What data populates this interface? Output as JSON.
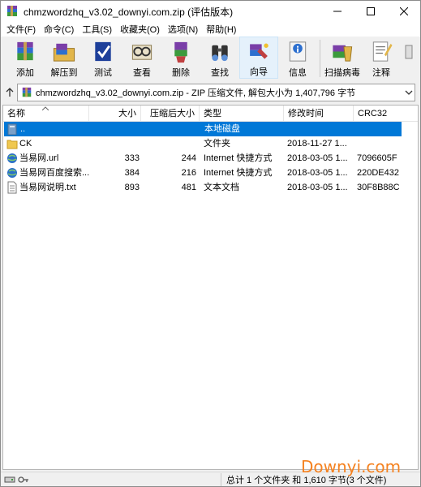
{
  "window": {
    "title": "chmzwordzhq_v3.02_downyi.com.zip (评估版本)",
    "controls": [
      "minimize",
      "maximize",
      "close"
    ]
  },
  "menu": [
    "文件(F)",
    "命令(C)",
    "工具(S)",
    "收藏夹(O)",
    "选项(N)",
    "帮助(H)"
  ],
  "toolbar": [
    {
      "label": "添加",
      "icon": "add-archive-icon"
    },
    {
      "label": "解压到",
      "icon": "extract-icon"
    },
    {
      "label": "测试",
      "icon": "test-icon"
    },
    {
      "label": "查看",
      "icon": "view-icon"
    },
    {
      "label": "删除",
      "icon": "delete-icon"
    },
    {
      "label": "查找",
      "icon": "find-icon"
    },
    {
      "label": "向导",
      "icon": "wizard-icon"
    },
    {
      "label": "信息",
      "icon": "info-icon"
    },
    {
      "label": "扫描病毒",
      "icon": "scan-virus-icon"
    },
    {
      "label": "注释",
      "icon": "comment-icon"
    }
  ],
  "address": {
    "text": "chmzwordzhq_v3.02_downyi.com.zip - ZIP 压缩文件, 解包大小为 1,407,796 字节"
  },
  "columns": {
    "name": "名称",
    "size": "大小",
    "packed": "压缩后大小",
    "type": "类型",
    "modified": "修改时间",
    "crc": "CRC32"
  },
  "files": [
    {
      "name": "..",
      "size": "",
      "packed": "",
      "type": "本地磁盘",
      "modified": "",
      "crc": "",
      "icon": "parent-folder-icon",
      "selected": true
    },
    {
      "name": "CK",
      "size": "",
      "packed": "",
      "type": "文件夹",
      "modified": "2018-11-27 1...",
      "crc": "",
      "icon": "folder-icon",
      "selected": false
    },
    {
      "name": "当易网.url",
      "size": "333",
      "packed": "244",
      "type": "Internet 快捷方式",
      "modified": "2018-03-05 1...",
      "crc": "7096605F",
      "icon": "internet-shortcut-icon",
      "selected": false
    },
    {
      "name": "当易网百度搜索...",
      "size": "384",
      "packed": "216",
      "type": "Internet 快捷方式",
      "modified": "2018-03-05 1...",
      "crc": "220DE432",
      "icon": "internet-shortcut-icon",
      "selected": false
    },
    {
      "name": "当易网说明.txt",
      "size": "893",
      "packed": "481",
      "type": "文本文档",
      "modified": "2018-03-05 1...",
      "crc": "30F8B88C",
      "icon": "text-file-icon",
      "selected": false
    }
  ],
  "status": {
    "summary": "总计 1 个文件夹 和 1,610 字节(3 个文件)"
  },
  "watermark": "Downyi.com",
  "colors": {
    "selection": "#0078d7",
    "watermark": "#f58220"
  }
}
